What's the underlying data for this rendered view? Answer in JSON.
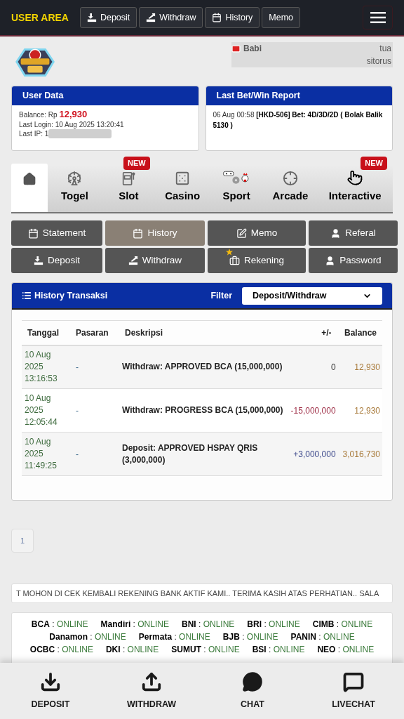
{
  "header": {
    "brand": "USER AREA",
    "nav": [
      {
        "label": "Deposit"
      },
      {
        "label": "Withdraw"
      },
      {
        "label": "History"
      },
      {
        "label": "Memo"
      }
    ]
  },
  "profile": {
    "name_start": "Babi",
    "name_end": "tua",
    "name_line2": "sitorus"
  },
  "user_data": {
    "title": "User Data",
    "balance_label": "Balance: Rp",
    "balance": "12,930",
    "last_login": "Last Login: 10 Aug 2025 13:20:41",
    "last_ip_label": "Last IP: 1"
  },
  "last_bet": {
    "title": "Last Bet/Win Report",
    "time": "06 Aug 00:58",
    "text": "[HKD-506] Bet: 4D/3D/2D ( Bolak Balik 5130 )"
  },
  "game_tabs": [
    {
      "selected": true
    },
    {
      "label": "Togel",
      "selected": false
    },
    {
      "label": "Slot",
      "selected": false,
      "badge": "NEW"
    },
    {
      "label": "Casino",
      "selected": false
    },
    {
      "label": "Sport",
      "selected": false
    },
    {
      "label": "Arcade",
      "selected": false
    },
    {
      "label": "Interactive",
      "selected": false,
      "badge": "NEW"
    }
  ],
  "menu_buttons": [
    {
      "label": "Statement",
      "selected": false
    },
    {
      "label": "History",
      "selected": true
    },
    {
      "label": "Memo",
      "selected": false
    },
    {
      "label": "Referal",
      "selected": false
    },
    {
      "label": "Deposit",
      "selected": false
    },
    {
      "label": "Withdraw",
      "selected": false
    },
    {
      "label": "Rekening",
      "selected": false
    },
    {
      "label": "Password",
      "selected": false
    }
  ],
  "history": {
    "title": "History Transaksi",
    "filter_label": "Filter",
    "filter_value": "Deposit/Withdraw",
    "columns": [
      "Tanggal",
      "Pasaran",
      "Deskripsi",
      "+/-",
      "Balance"
    ],
    "rows": [
      {
        "date": "10 Aug 2025 13:16:53",
        "market": "-",
        "description": "Withdraw: APPROVED BCA (15,000,000)",
        "change": "0",
        "color": "#333333",
        "balance": "12,930"
      },
      {
        "date": "10 Aug 2025 12:05:44",
        "market": "-",
        "description": "Withdraw: PROGRESS BCA (15,000,000)",
        "change": "-15,000,000",
        "color": "#a0324a",
        "balance": "12,930"
      },
      {
        "date": "10 Aug 2025 11:49:25",
        "market": "-",
        "description": "Deposit: APPROVED HSPAY QRIS (3,000,000)",
        "change": "+3,000,000",
        "color": "#3e4a8c",
        "balance": "3,016,730"
      }
    ]
  },
  "pagination": [
    {
      "label": "1",
      "selected": true
    }
  ],
  "marquee": "T MOHON DI CEK KEMBALI REKENING BANK AKTIF KAMI.. TERIMA KASIH ATAS PERHATIAN.. SALA",
  "bank_rows": [
    [
      {
        "name": "BCA",
        "separator": ":",
        "status": "ONLINE"
      },
      {
        "name": "Mandiri",
        "separator": ":",
        "status": "ONLINE"
      },
      {
        "name": "BNI",
        "separator": ":",
        "status": "ONLINE"
      },
      {
        "name": "BRI",
        "separator": ":",
        "status": "ONLINE"
      },
      {
        "name": "CIMB",
        "separator": ":",
        "status": "ONLINE"
      }
    ],
    [
      {
        "name": "Danamon",
        "separator": ":",
        "status": "ONLINE"
      },
      {
        "name": "Permata",
        "separator": ":",
        "status": "ONLINE"
      },
      {
        "name": "BJB",
        "separator": ":",
        "status": "ONLINE"
      },
      {
        "name": "PANIN",
        "separator": ":",
        "status": "ONLINE"
      }
    ],
    [
      {
        "name": "OCBC",
        "separator": ":",
        "status": "ONLINE"
      },
      {
        "name": "DKI",
        "separator": ":",
        "status": "ONLINE"
      },
      {
        "name": "SUMUT",
        "separator": ":",
        "status": "ONLINE"
      },
      {
        "name": "BSI",
        "separator": ":",
        "status": "ONLINE"
      },
      {
        "name": "NEO",
        "separator": ":",
        "status": "ONLINE"
      }
    ]
  ],
  "bottom_nav": [
    {
      "label": "DEPOSIT"
    },
    {
      "label": "WITHDRAW"
    },
    {
      "label": "CHAT"
    },
    {
      "label": "LIVECHAT"
    }
  ]
}
